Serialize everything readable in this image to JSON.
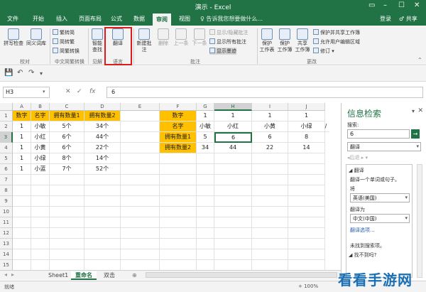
{
  "window": {
    "title": "演示 - Excel",
    "controls": [
      "▭",
      "–",
      "☐",
      "✕"
    ]
  },
  "tabs": {
    "items": [
      "文件",
      "开始",
      "插入",
      "页面布局",
      "公式",
      "数据",
      "审阅",
      "视图"
    ],
    "active": "审阅",
    "tell_me": "♀ 告诉我您想要做什么...",
    "login": "登录",
    "share": "♂ 共享"
  },
  "ribbon": {
    "proofing": {
      "label": "校对",
      "spell": "拼写检查",
      "thesaurus": "同义词库"
    },
    "chinese": {
      "label": "中文简繁转换",
      "to_simp": "繁转简",
      "to_trad": "简转繁",
      "convert": "简繁转换"
    },
    "insights": {
      "label": "见解",
      "smart": "智能\n查找"
    },
    "language": {
      "label": "语言",
      "translate": "翻译"
    },
    "comments": {
      "label": "批注",
      "new": "新建批注",
      "delete": "删除",
      "prev": "上一条",
      "next": "下一条",
      "show_hide": "显示/隐藏批注",
      "show_all": "显示所有批注",
      "show_ink": "显示墨迹"
    },
    "changes": {
      "label": "更改",
      "protect_sheet": "保护\n工作表",
      "protect_book": "保护\n工作簿",
      "share_book": "共享\n工作簿",
      "protect_share": "保护并共享工作簿",
      "allow_edit": "允许用户编辑区域",
      "track": "修订 ▾"
    }
  },
  "qat": {
    "save": "💾",
    "undo": "↶",
    "redo": "↷",
    "more": "▾"
  },
  "formula_bar": {
    "name_box": "H3",
    "cancel": "✕",
    "enter": "✓",
    "fx": "fx",
    "formula": "6"
  },
  "sheet": {
    "columns": [
      "A",
      "B",
      "C",
      "D",
      "E",
      "F",
      "G",
      "H",
      "I",
      "J"
    ],
    "selected_column": "H",
    "rows": [
      "1",
      "2",
      "3",
      "4",
      "5",
      "6",
      "7",
      "8",
      "9",
      "10",
      "11",
      "12",
      "13",
      "14",
      "15"
    ],
    "selected_row": "3",
    "table1": {
      "header": [
        "数字",
        "名字",
        "拥有数量1",
        "拥有数量2"
      ],
      "rows": [
        [
          "1",
          "小敏",
          "5个",
          "34个"
        ],
        [
          "1",
          "小红",
          "6个",
          "44个"
        ],
        [
          "1",
          "小黄",
          "6个",
          "22个"
        ],
        [
          "1",
          "小绿",
          "8个",
          "14个"
        ],
        [
          "1",
          "小蓝",
          "7个",
          "52个"
        ]
      ]
    },
    "table2": {
      "row_labels": [
        "数字",
        "名字",
        "拥有数量1",
        "拥有数量2"
      ],
      "values": [
        [
          "1",
          "1",
          "1",
          "1"
        ],
        [
          "小敏",
          "小红",
          "小黄",
          "小绿"
        ],
        [
          "5",
          "6",
          "6",
          "8"
        ],
        [
          "34",
          "44",
          "22",
          "14"
        ]
      ],
      "overflow": "/"
    }
  },
  "sheet_tabs": {
    "items": [
      "Sheet1",
      "重命名",
      "双击"
    ],
    "active": "重命名",
    "add": "⊕"
  },
  "status": {
    "left": "就绪",
    "zoom": "+ 100%"
  },
  "research_pane": {
    "title": "信息检索",
    "close": "✕",
    "menu": "▾",
    "search_label": "搜索:",
    "search_value": "6",
    "go": "→",
    "source": "翻译",
    "nav": "◂后退 ▸ ▾",
    "section": "◢ 翻译",
    "description": "翻译一个单词或句子。",
    "from_label": "将",
    "from_value": "英语(美国)",
    "to_label": "翻译为",
    "to_value": "中文(中国)",
    "options": "翻译选项...",
    "not_found": "未找到搜索项。",
    "no_results": "◢ 找不到吗?"
  },
  "watermark": "看看手游网",
  "colors": {
    "excel_green": "#217346",
    "highlight": "#ffc000",
    "red_box": "#e0191c"
  }
}
